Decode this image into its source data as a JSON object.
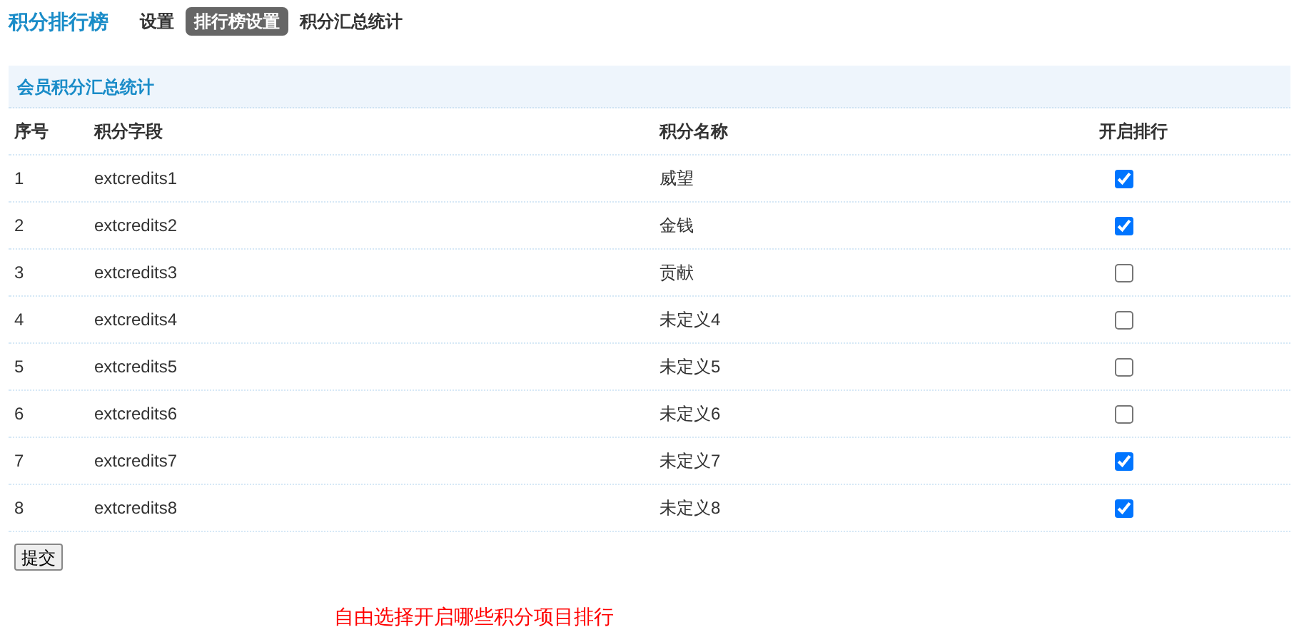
{
  "title": "积分排行榜",
  "tabs": [
    {
      "label": "设置",
      "selected": false
    },
    {
      "label": "排行榜设置",
      "selected": true
    },
    {
      "label": "积分汇总统计",
      "selected": false
    }
  ],
  "panel": {
    "title": "会员积分汇总统计"
  },
  "table": {
    "columns": [
      "序号",
      "积分字段",
      "积分名称",
      "开启排行"
    ],
    "rows": [
      {
        "index": "1",
        "field": "extcredits1",
        "name": "威望",
        "checked": true
      },
      {
        "index": "2",
        "field": "extcredits2",
        "name": "金钱",
        "checked": true
      },
      {
        "index": "3",
        "field": "extcredits3",
        "name": "贡献",
        "checked": false
      },
      {
        "index": "4",
        "field": "extcredits4",
        "name": "未定义4",
        "checked": false
      },
      {
        "index": "5",
        "field": "extcredits5",
        "name": "未定义5",
        "checked": false
      },
      {
        "index": "6",
        "field": "extcredits6",
        "name": "未定义6",
        "checked": false
      },
      {
        "index": "7",
        "field": "extcredits7",
        "name": "未定义7",
        "checked": true
      },
      {
        "index": "8",
        "field": "extcredits8",
        "name": "未定义8",
        "checked": true
      }
    ]
  },
  "submit": "提交",
  "note": "自由选择开启哪些积分项目排行"
}
